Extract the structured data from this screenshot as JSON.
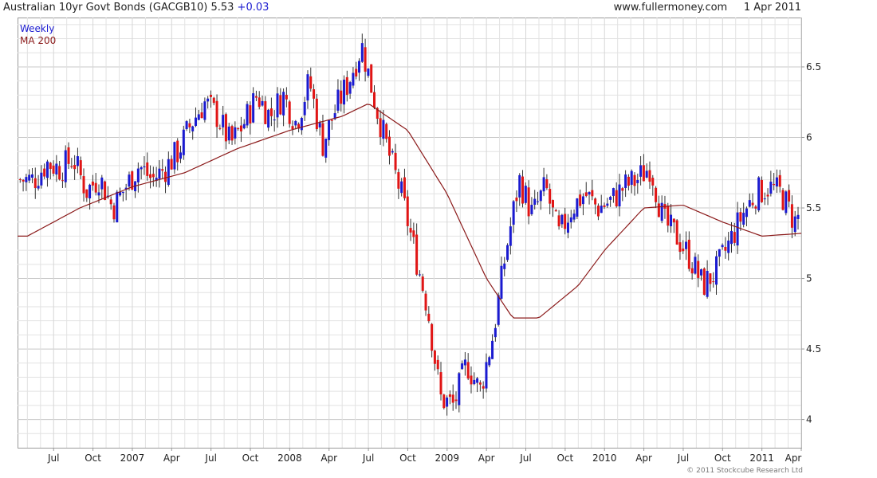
{
  "header": {
    "title": "Australian 10yr Govt Bonds (GACGB10)",
    "last": "5.53",
    "change": "+0.03",
    "site": "www.fullermoney.com",
    "date": "1 Apr 2011"
  },
  "footer": {
    "copyright": "© 2011 Stockcube Research Ltd"
  },
  "colors": {
    "up": "#1a1ad0",
    "down": "#e01515",
    "ma": "#8b1a1a",
    "grid": "#e2e2e2",
    "axis": "#9a9a9a"
  },
  "chart_data": {
    "type": "candlestick",
    "legend": [
      {
        "label": "Weekly",
        "color": "#1a1ad0"
      },
      {
        "label": "MA 200",
        "color": "#8b1a1a"
      }
    ],
    "legend_position": "top-left",
    "grid": true,
    "y_axis_position": "right",
    "ylim": [
      3.8,
      6.85
    ],
    "y_ticks": [
      4,
      4.5,
      5,
      5.5,
      6,
      6.5
    ],
    "x_ticks": [
      "Jul",
      "Oct",
      "2007",
      "Apr",
      "Jul",
      "Oct",
      "2008",
      "Apr",
      "Jul",
      "Oct",
      "2009",
      "Apr",
      "Jul",
      "Oct",
      "2010",
      "Apr",
      "Jul",
      "Oct",
      "2011",
      "Apr"
    ],
    "close_series": [
      {
        "date": "2006-05",
        "close": 5.7
      },
      {
        "date": "2006-06",
        "close": 5.82
      },
      {
        "date": "2006-07",
        "close": 5.78
      },
      {
        "date": "2006-08",
        "close": 5.85
      },
      {
        "date": "2006-09",
        "close": 5.62
      },
      {
        "date": "2006-10",
        "close": 5.72
      },
      {
        "date": "2006-11",
        "close": 5.5
      },
      {
        "date": "2006-12",
        "close": 5.65
      },
      {
        "date": "2007-01",
        "close": 5.8
      },
      {
        "date": "2007-02",
        "close": 5.7
      },
      {
        "date": "2007-03",
        "close": 5.78
      },
      {
        "date": "2007-04",
        "close": 5.9
      },
      {
        "date": "2007-05",
        "close": 6.1
      },
      {
        "date": "2007-06",
        "close": 6.25
      },
      {
        "date": "2007-07",
        "close": 6.15
      },
      {
        "date": "2007-08",
        "close": 5.95
      },
      {
        "date": "2007-09",
        "close": 6.1
      },
      {
        "date": "2007-10",
        "close": 6.3
      },
      {
        "date": "2007-11",
        "close": 6.15
      },
      {
        "date": "2007-12",
        "close": 6.3
      },
      {
        "date": "2008-01",
        "close": 6.1
      },
      {
        "date": "2008-02",
        "close": 6.4
      },
      {
        "date": "2008-03",
        "close": 5.95
      },
      {
        "date": "2008-04",
        "close": 6.2
      },
      {
        "date": "2008-05",
        "close": 6.4
      },
      {
        "date": "2008-06",
        "close": 6.65
      },
      {
        "date": "2008-07",
        "close": 6.25
      },
      {
        "date": "2008-08",
        "close": 5.9
      },
      {
        "date": "2008-09",
        "close": 5.6
      },
      {
        "date": "2008-10",
        "close": 5.2
      },
      {
        "date": "2008-11",
        "close": 4.8
      },
      {
        "date": "2008-12",
        "close": 4.15
      },
      {
        "date": "2009-01",
        "close": 4.1
      },
      {
        "date": "2009-02",
        "close": 4.4
      },
      {
        "date": "2009-03",
        "close": 4.2
      },
      {
        "date": "2009-04",
        "close": 4.6
      },
      {
        "date": "2009-05",
        "close": 5.2
      },
      {
        "date": "2009-06",
        "close": 5.7
      },
      {
        "date": "2009-07",
        "close": 5.45
      },
      {
        "date": "2009-08",
        "close": 5.65
      },
      {
        "date": "2009-09",
        "close": 5.3
      },
      {
        "date": "2009-10",
        "close": 5.5
      },
      {
        "date": "2009-11",
        "close": 5.6
      },
      {
        "date": "2009-12",
        "close": 5.5
      },
      {
        "date": "2010-01",
        "close": 5.55
      },
      {
        "date": "2010-02",
        "close": 5.65
      },
      {
        "date": "2010-03",
        "close": 5.7
      },
      {
        "date": "2010-04",
        "close": 5.8
      },
      {
        "date": "2010-05",
        "close": 5.4
      },
      {
        "date": "2010-06",
        "close": 5.3
      },
      {
        "date": "2010-07",
        "close": 5.15
      },
      {
        "date": "2010-08",
        "close": 4.95
      },
      {
        "date": "2010-09",
        "close": 5.05
      },
      {
        "date": "2010-10",
        "close": 5.25
      },
      {
        "date": "2010-11",
        "close": 5.45
      },
      {
        "date": "2010-12",
        "close": 5.6
      },
      {
        "date": "2011-01",
        "close": 5.65
      },
      {
        "date": "2011-02",
        "close": 5.6
      },
      {
        "date": "2011-03",
        "close": 5.4
      },
      {
        "date": "2011-04",
        "close": 5.53
      }
    ],
    "ma200": [
      {
        "date": "2006-05",
        "value": 5.3
      },
      {
        "date": "2006-09",
        "value": 5.5
      },
      {
        "date": "2007-01",
        "value": 5.65
      },
      {
        "date": "2007-05",
        "value": 5.75
      },
      {
        "date": "2007-09",
        "value": 5.92
      },
      {
        "date": "2008-01",
        "value": 6.05
      },
      {
        "date": "2008-05",
        "value": 6.15
      },
      {
        "date": "2008-07",
        "value": 6.24
      },
      {
        "date": "2008-10",
        "value": 6.05
      },
      {
        "date": "2009-01",
        "value": 5.6
      },
      {
        "date": "2009-04",
        "value": 5.0
      },
      {
        "date": "2009-06",
        "value": 4.72
      },
      {
        "date": "2009-08",
        "value": 4.72
      },
      {
        "date": "2009-11",
        "value": 4.95
      },
      {
        "date": "2010-01",
        "value": 5.2
      },
      {
        "date": "2010-04",
        "value": 5.5
      },
      {
        "date": "2010-07",
        "value": 5.52
      },
      {
        "date": "2010-10",
        "value": 5.4
      },
      {
        "date": "2011-01",
        "value": 5.3
      },
      {
        "date": "2011-04",
        "value": 5.32
      }
    ]
  }
}
